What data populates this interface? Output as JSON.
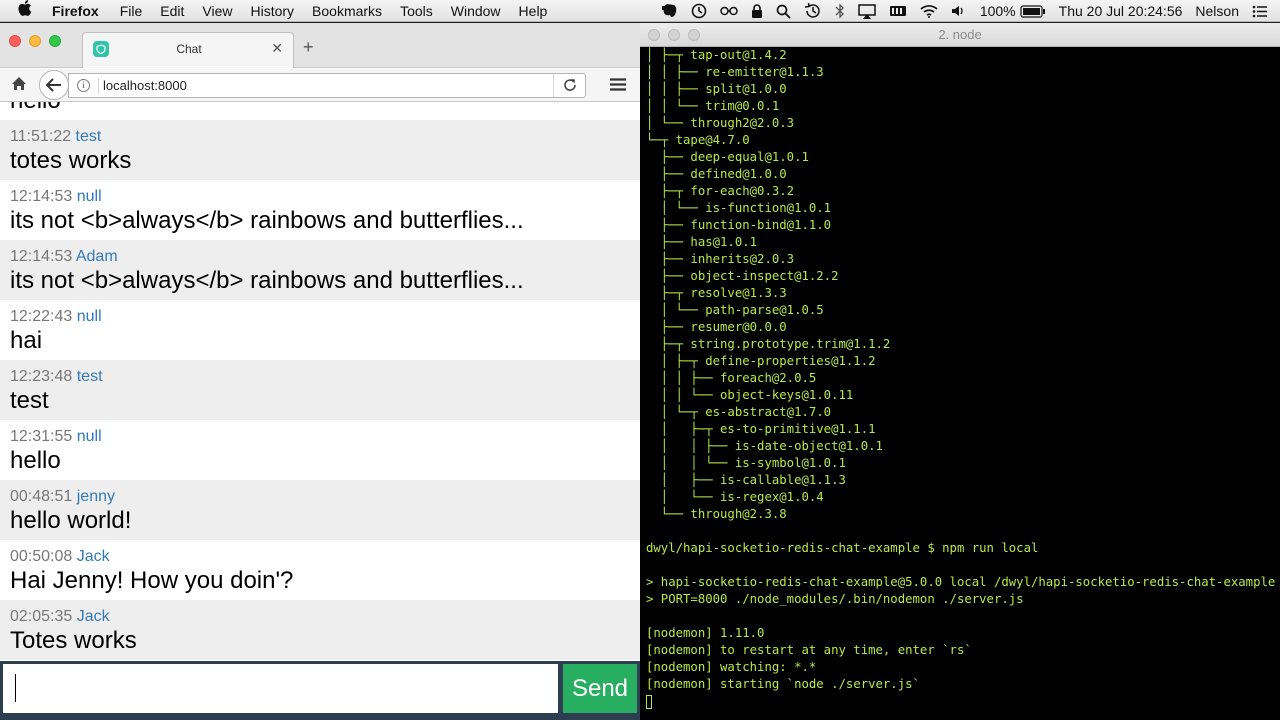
{
  "menubar": {
    "app_name": "Firefox",
    "menus": [
      "File",
      "Edit",
      "View",
      "History",
      "Bookmarks",
      "Tools",
      "Window",
      "Help"
    ],
    "battery": "100%",
    "clock": "Thu 20 Jul  20:24:56",
    "user": "Nelson"
  },
  "browser": {
    "tab_title": "Chat",
    "url": "localhost:8000"
  },
  "chat": {
    "partial_message": "hello",
    "messages": [
      {
        "time": "11:51:22",
        "user": "test",
        "text": "totes works"
      },
      {
        "time": "12:14:53",
        "user": "null",
        "text": "its not <b>always</b> rainbows and butterflies..."
      },
      {
        "time": "12:14:53",
        "user": "Adam",
        "text": "its not <b>always</b> rainbows and butterflies..."
      },
      {
        "time": "12:22:43",
        "user": "null",
        "text": "hai"
      },
      {
        "time": "12:23:48",
        "user": "test",
        "text": "test"
      },
      {
        "time": "12:31:55",
        "user": "null",
        "text": "hello"
      },
      {
        "time": "00:48:51",
        "user": "jenny",
        "text": "hello world!"
      },
      {
        "time": "00:50:08",
        "user": "Jack",
        "text": "Hai Jenny! How you doin'?"
      },
      {
        "time": "02:05:35",
        "user": "Jack",
        "text": "Totes works"
      }
    ],
    "input_value": "",
    "send_label": "Send"
  },
  "terminal": {
    "title": "2. node",
    "lines": [
      "│ ├─┬ tap-out@1.4.2",
      "│ │ ├── re-emitter@1.1.3",
      "│ │ ├── split@1.0.0",
      "│ │ └── trim@0.0.1",
      "│ └── through2@2.0.3",
      "└─┬ tape@4.7.0",
      "  ├── deep-equal@1.0.1",
      "  ├── defined@1.0.0",
      "  ├─┬ for-each@0.3.2",
      "  │ └── is-function@1.0.1",
      "  ├── function-bind@1.1.0",
      "  ├── has@1.0.1",
      "  ├── inherits@2.0.3",
      "  ├── object-inspect@1.2.2",
      "  ├─┬ resolve@1.3.3",
      "  │ └── path-parse@1.0.5",
      "  ├── resumer@0.0.0",
      "  ├─┬ string.prototype.trim@1.1.2",
      "  │ ├─┬ define-properties@1.1.2",
      "  │ │ ├── foreach@2.0.5",
      "  │ │ └── object-keys@1.0.11",
      "  │ └─┬ es-abstract@1.7.0",
      "  │   ├─┬ es-to-primitive@1.1.1",
      "  │   │ ├── is-date-object@1.0.1",
      "  │   │ └── is-symbol@1.0.1",
      "  │   ├── is-callable@1.1.3",
      "  │   └── is-regex@1.0.4",
      "  └── through@2.3.8",
      "",
      "dwyl/hapi-socketio-redis-chat-example $ npm run local",
      "",
      "> hapi-socketio-redis-chat-example@5.0.0 local /dwyl/hapi-socketio-redis-chat-example",
      "> PORT=8000 ./node_modules/.bin/nodemon ./server.js",
      "",
      "[nodemon] 1.11.0",
      "[nodemon] to restart at any time, enter `rs`",
      "[nodemon] watching: *.*",
      "[nodemon] starting `node ./server.js`"
    ]
  }
}
